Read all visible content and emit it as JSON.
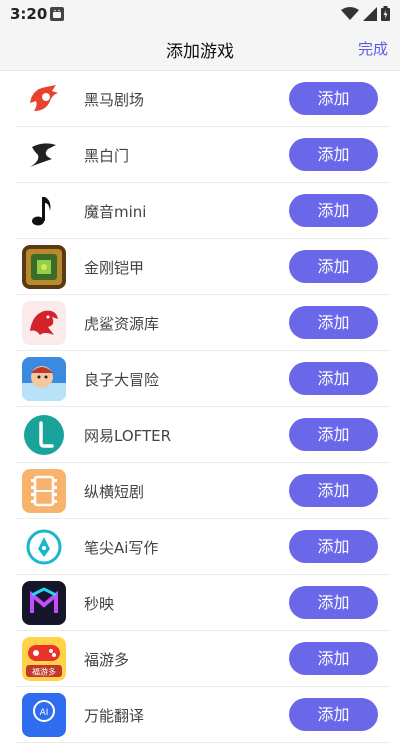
{
  "status_bar": {
    "time": "3:20"
  },
  "header": {
    "title": "添加游戏",
    "done_label": "完成"
  },
  "items": [
    {
      "name": "黑马剧场",
      "button": "添加",
      "icon": "horse-logo-icon"
    },
    {
      "name": "黑白门",
      "button": "添加",
      "icon": "black-white-gate-icon"
    },
    {
      "name": "魔音mini",
      "button": "添加",
      "icon": "music-note-icon"
    },
    {
      "name": "金刚铠甲",
      "button": "添加",
      "icon": "armor-game-icon"
    },
    {
      "name": "虎鲨资源库",
      "button": "添加",
      "icon": "red-dragon-icon"
    },
    {
      "name": "良子大冒险",
      "button": "添加",
      "icon": "adventure-character-icon"
    },
    {
      "name": "网易LOFTER",
      "button": "添加",
      "icon": "lofter-l-icon"
    },
    {
      "name": "纵横短剧",
      "button": "添加",
      "icon": "film-strip-icon"
    },
    {
      "name": "笔尖Ai写作",
      "button": "添加",
      "icon": "pen-tip-icon"
    },
    {
      "name": "秒映",
      "button": "添加",
      "icon": "m-logo-icon"
    },
    {
      "name": "福游多",
      "button": "添加",
      "icon": "game-controller-icon"
    },
    {
      "name": "万能翻译",
      "button": "添加",
      "icon": "ai-translate-icon"
    }
  ],
  "icon_badge_text": {
    "fuyouduo": "福游多",
    "ai": "AI"
  },
  "colors": {
    "accent": "#6a68e8",
    "done": "#5b5be6"
  }
}
